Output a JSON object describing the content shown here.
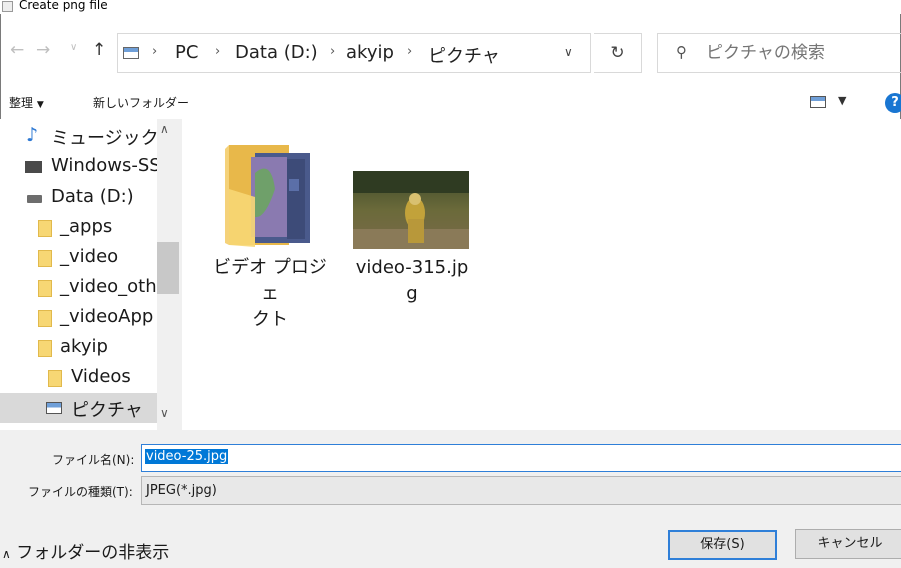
{
  "window": {
    "title": "Create png file"
  },
  "nav": {
    "back_icon": "arrow-left-icon",
    "forward_icon": "arrow-right-icon",
    "up_icon": "arrow-up-icon",
    "breadcrumbs": [
      "PC",
      "Data (D:)",
      "akyip",
      "ピクチャ"
    ],
    "search_placeholder": "ピクチャの検索"
  },
  "toolbar": {
    "organize_label": "整理",
    "new_folder_label": "新しいフォルダー"
  },
  "sidebar": {
    "items": [
      {
        "label": "ミュージック",
        "icon": "music-icon"
      },
      {
        "label": "Windows-SS",
        "icon": "windows-drive-icon"
      },
      {
        "label": "Data (D:)",
        "icon": "drive-icon"
      },
      {
        "label": "_apps",
        "icon": "folder-icon"
      },
      {
        "label": "_video",
        "icon": "folder-icon"
      },
      {
        "label": "_video_oth",
        "icon": "folder-icon"
      },
      {
        "label": "_videoApp",
        "icon": "folder-icon"
      },
      {
        "label": "akyip",
        "icon": "folder-icon"
      },
      {
        "label": "Videos",
        "icon": "folder-icon"
      },
      {
        "label": "ピクチャ",
        "icon": "pictures-icon",
        "selected": true
      }
    ]
  },
  "files": [
    {
      "name": "ビデオ プロジェクト",
      "line1": "ビデオ プロジェ",
      "line2": "クト",
      "type": "folder"
    },
    {
      "name": "video-315.jpg",
      "line1": "video-315.jp",
      "line2": "g",
      "type": "image"
    }
  ],
  "form": {
    "filename_label": "ファイル名(N):",
    "filename_value": "video-25.jpg",
    "filetype_label": "ファイルの種類(T):",
    "filetype_value": "JPEG(*.jpg)"
  },
  "footer": {
    "hide_folders_label": "フォルダーの非表示",
    "save_label": "保存(S)",
    "cancel_label": "キャンセル"
  },
  "colors": {
    "accent": "#0078d7",
    "selection_bg": "#d9d9d9",
    "folder": "#f7d774"
  }
}
